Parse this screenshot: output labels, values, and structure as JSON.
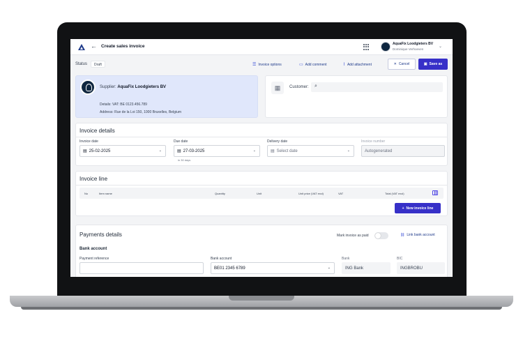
{
  "header": {
    "title": "Create sales invoice",
    "company": "AquaFix Loodgieters BV",
    "user": "Dominique Verhoeven"
  },
  "toolbar": {
    "status_label": "Status",
    "status_value": "Draft",
    "invoice_options": "Invoice options",
    "add_comment": "Add comment",
    "add_attachment": "Add attachment",
    "cancel": "Cancel",
    "save_as": "Save as"
  },
  "supplier": {
    "label": "Supplier:",
    "name": "AquaFix Loodgieters BV",
    "details": "Details: VAT: BE 0123.456.789",
    "address": "Address: Rue de la Loi 150, 1000 Bruxelles, Belgium"
  },
  "customer": {
    "label": "Customer:"
  },
  "invoice_details": {
    "title": "Invoice details",
    "invoice_date_label": "Invoice date",
    "invoice_date": "25-02-2025",
    "due_date_label": "Due date",
    "due_date": "27-03-2025",
    "due_hint": "in 30 days",
    "delivery_date_label": "Delivery date",
    "delivery_placeholder": "Select date",
    "invoice_number_label": "Invoice number",
    "invoice_number": "Autogenerated"
  },
  "invoice_line": {
    "title": "Invoice line",
    "columns": [
      "No",
      "Item name",
      "Quantity",
      "Unit",
      "Unit price (VAT excl)",
      "VAT",
      "Total (VAT excl)"
    ],
    "new_line": "New invoice line"
  },
  "payments": {
    "title": "Payments details",
    "mark_paid": "Mark invoice as paid",
    "link_bank": "Link bank account",
    "bank_account_title": "Bank account",
    "payment_reference_label": "Payment reference",
    "payment_reference": "",
    "bank_account_label": "Bank account",
    "bank_account": "BE01 2345 6789",
    "bank_label": "Bank",
    "bank": "ING Bank",
    "bic_label": "BIC",
    "bic": "INGBROBU"
  },
  "colors": {
    "accent": "#3730c8",
    "supplier_bg": "#e0e7fb"
  }
}
